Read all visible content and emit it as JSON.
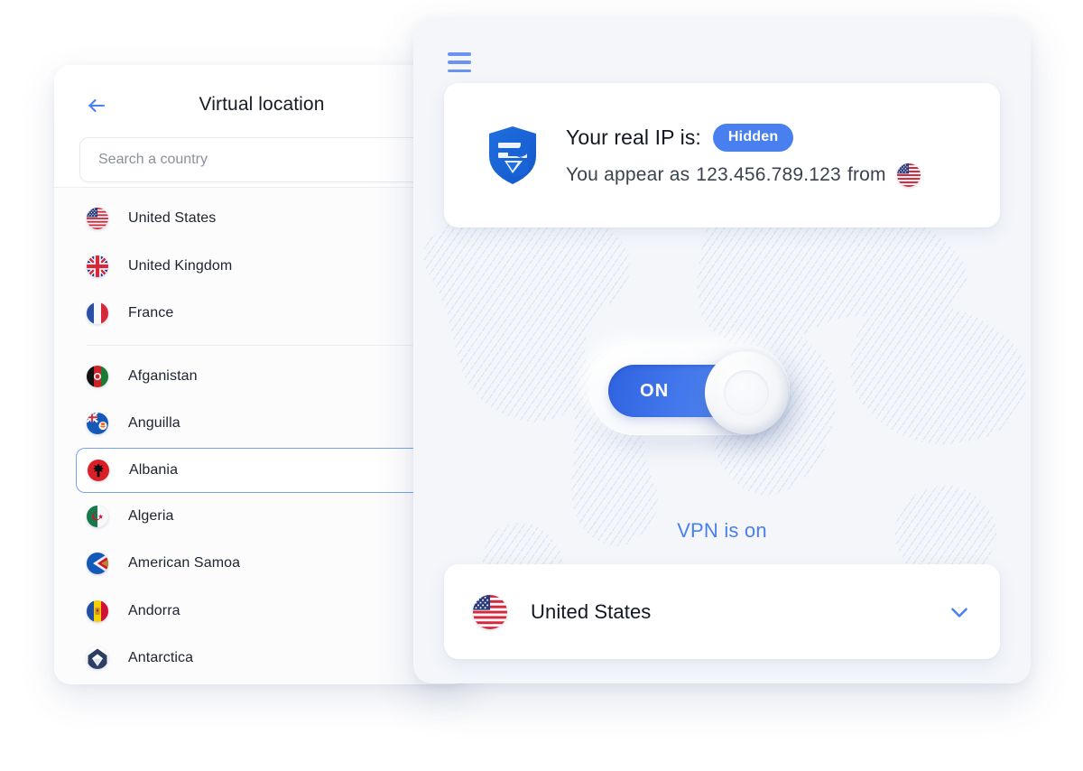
{
  "left_panel": {
    "back_icon": "back-arrow-icon",
    "title": "Virtual location",
    "search": {
      "placeholder": "Search a country",
      "value": ""
    },
    "recent": [
      {
        "name": "United States",
        "flag": "us"
      },
      {
        "name": "United Kingdom",
        "flag": "gb"
      },
      {
        "name": "France",
        "flag": "fr"
      }
    ],
    "countries": [
      {
        "name": "Afganistan",
        "flag": "af",
        "selected": false
      },
      {
        "name": "Anguilla",
        "flag": "ai",
        "selected": false
      },
      {
        "name": "Albania",
        "flag": "al",
        "selected": true
      },
      {
        "name": "Algeria",
        "flag": "dz",
        "selected": false
      },
      {
        "name": "American Samoa",
        "flag": "as",
        "selected": false
      },
      {
        "name": "Andorra",
        "flag": "ad",
        "selected": false
      },
      {
        "name": "Antarctica",
        "flag": "aq",
        "selected": false
      }
    ]
  },
  "right_panel": {
    "menu_icon": "hamburger-menu-icon",
    "logo_icon": "shield-logo-icon",
    "ip_card": {
      "real_ip_label": "Your real IP is:",
      "real_ip_badge": "Hidden",
      "appear_prefix": "You appear as",
      "appear_ip": "123.456.789.123",
      "appear_suffix": "from",
      "appear_flag": "us"
    },
    "toggle": {
      "state_label": "ON",
      "is_on": true
    },
    "status_text": "VPN is on",
    "selected_country": {
      "name": "United States",
      "flag": "us",
      "chevron_icon": "chevron-down-icon"
    }
  },
  "colors": {
    "accent_blue": "#4a7ff0",
    "badge_blue": "#4a7ff0",
    "panel_bg": "#f4f6fa",
    "card_white": "#ffffff",
    "text_dark": "#111723",
    "text_muted": "#8a909c",
    "selected_border": "#76a2f0"
  }
}
